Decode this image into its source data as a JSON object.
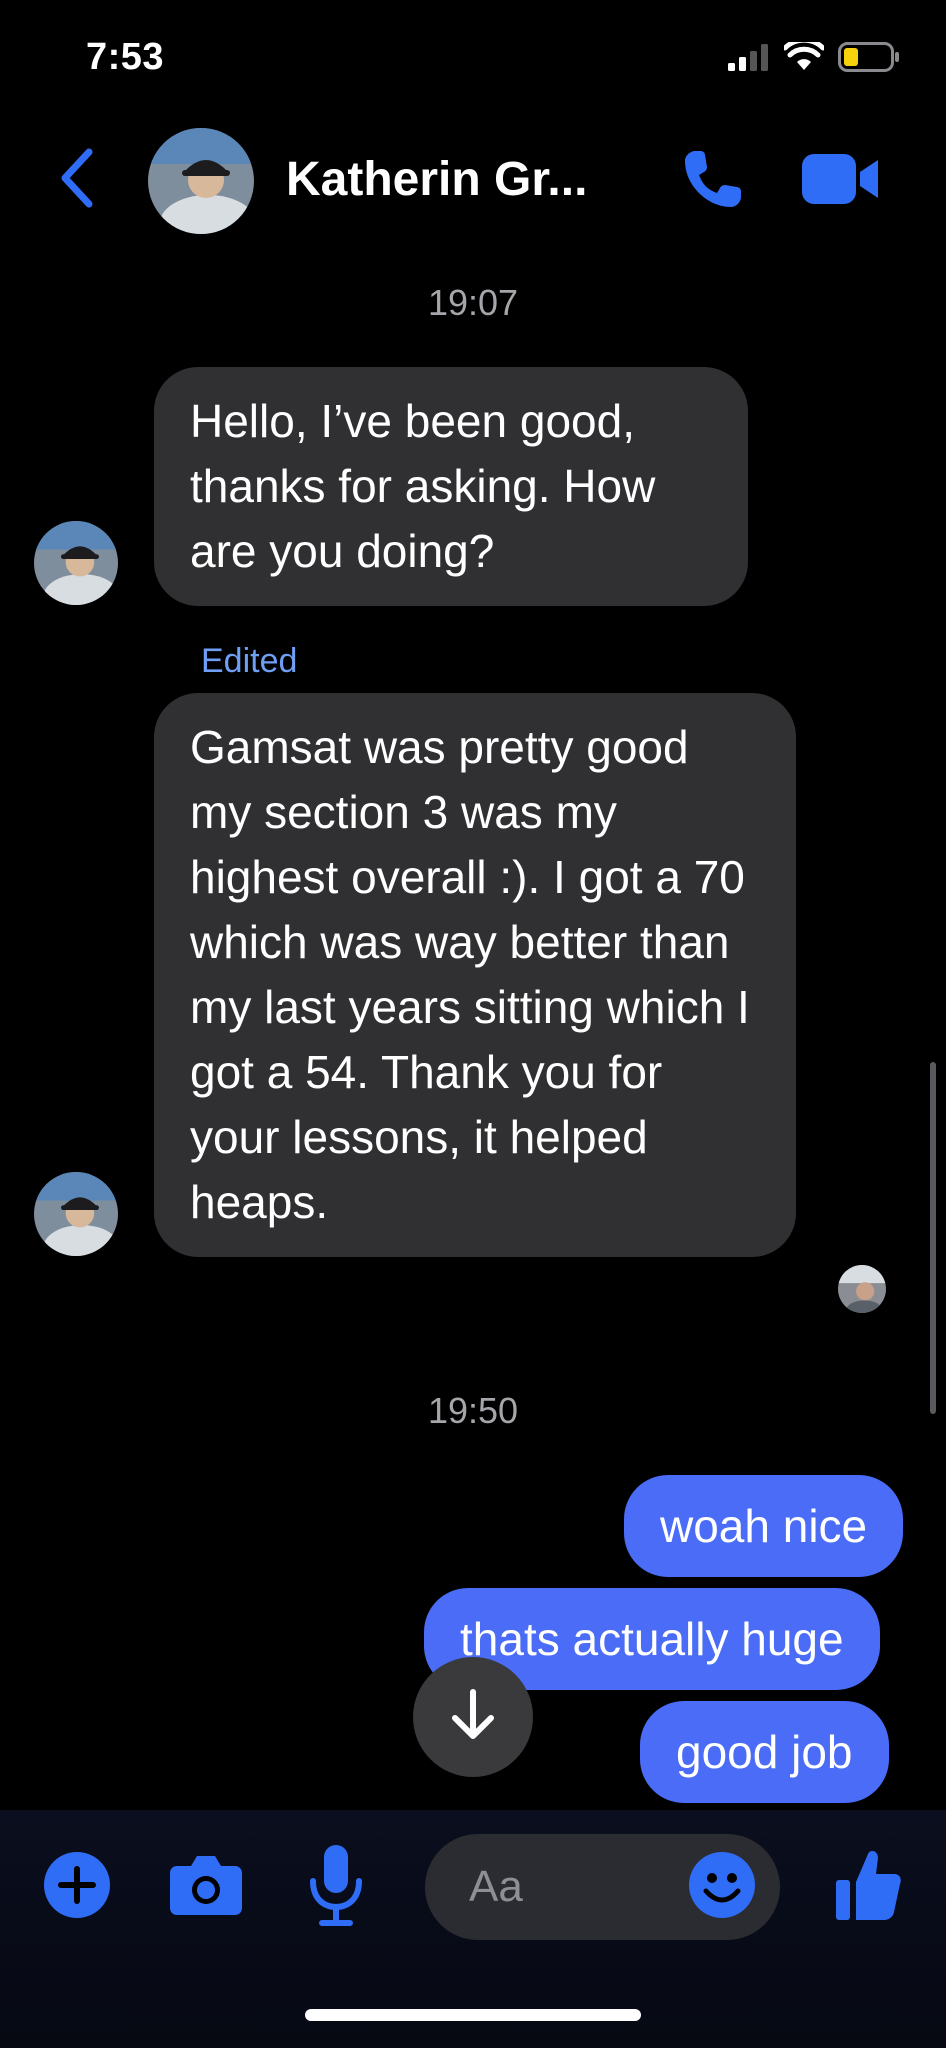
{
  "status_bar": {
    "time": "7:53",
    "icons": [
      "signal-icon",
      "wifi-icon",
      "battery-icon"
    ],
    "battery_color": "#f5d20c"
  },
  "header": {
    "contact_name": "Katherin Gr...",
    "back_icon": "chevron-left-icon",
    "call_icon": "phone-icon",
    "video_icon": "video-camera-icon",
    "accent_color": "#2f6df6"
  },
  "conversation": {
    "timestamp_1": "19:07",
    "messages_in": [
      {
        "text": "Hello, I’ve been good, thanks for asking. How are you doing?",
        "edited": false
      },
      {
        "text": "Gamsat was pretty good my section 3 was my highest overall :). I got a 70 which was way better than my last years sitting which I got a 54. Thank you for your lessons, it helped heaps.",
        "edited": true
      }
    ],
    "edited_label": "Edited",
    "timestamp_2": "19:50",
    "messages_out": [
      {
        "text": "woah nice"
      },
      {
        "text": "thats actually huge"
      },
      {
        "text": "good job"
      }
    ],
    "outgoing_color": "#4a6cf7",
    "incoming_color": "#303032"
  },
  "composer": {
    "placeholder": "Aa",
    "buttons": [
      "plus-icon",
      "camera-icon",
      "microphone-icon",
      "emoji-icon",
      "thumbs-up-icon"
    ]
  }
}
